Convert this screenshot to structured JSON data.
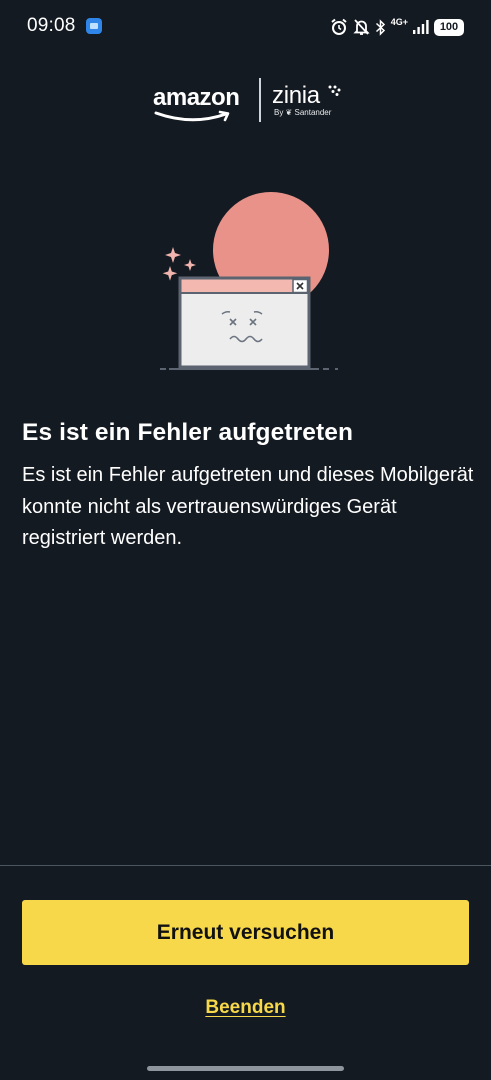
{
  "status_bar": {
    "time": "09:08",
    "network": "4G+",
    "battery": "100",
    "icons": [
      "app-notification-icon",
      "alarm-icon",
      "silent-mode-icon",
      "bluetooth-icon",
      "signal-icon",
      "battery-icon"
    ]
  },
  "brand": {
    "amazon": "amazon",
    "zinia": "zinia",
    "zinia_sub": "By ❦ Santander"
  },
  "illustration": {
    "icon": "error-window-icon",
    "colors": {
      "circle": "#e8928a",
      "window_bar": "#f3b8b0",
      "window_body": "#ededed",
      "sparkle": "#f2b4ae"
    }
  },
  "error": {
    "title": "Es ist ein Fehler aufgetreten",
    "message": "Es ist ein Fehler aufgetreten und dieses Mobilgerät konnte nicht als vertrauenswürdiges Gerät registriert werden."
  },
  "actions": {
    "retry_label": "Erneut versuchen",
    "exit_label": "Beenden"
  },
  "theme": {
    "background": "#141a21",
    "accent": "#f7d84a"
  }
}
